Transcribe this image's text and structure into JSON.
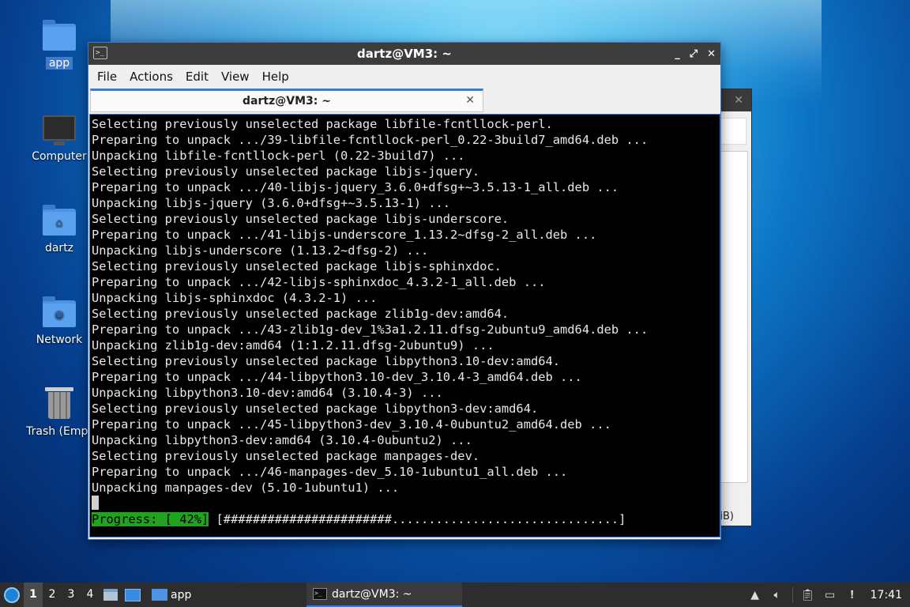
{
  "desktop": {
    "icons": [
      {
        "label": "app"
      },
      {
        "label": "Computer"
      },
      {
        "label": "dartz"
      },
      {
        "label": "Network"
      },
      {
        "label": "Trash (Empt"
      }
    ]
  },
  "background_window": {
    "close_glyph": "✕",
    "partial_text": "iB)"
  },
  "terminal_window": {
    "title": "dartz@VM3: ~",
    "controls": {
      "minimize": "_",
      "maximize": "⤢",
      "close": "✕"
    },
    "menu": [
      "File",
      "Actions",
      "Edit",
      "View",
      "Help"
    ],
    "tab": {
      "label": "dartz@VM3: ~",
      "close": "✕"
    },
    "lines": [
      "Selecting previously unselected package libfile-fcntllock-perl.",
      "Preparing to unpack .../39-libfile-fcntllock-perl_0.22-3build7_amd64.deb ...",
      "Unpacking libfile-fcntllock-perl (0.22-3build7) ...",
      "Selecting previously unselected package libjs-jquery.",
      "Preparing to unpack .../40-libjs-jquery_3.6.0+dfsg+~3.5.13-1_all.deb ...",
      "Unpacking libjs-jquery (3.6.0+dfsg+~3.5.13-1) ...",
      "Selecting previously unselected package libjs-underscore.",
      "Preparing to unpack .../41-libjs-underscore_1.13.2~dfsg-2_all.deb ...",
      "Unpacking libjs-underscore (1.13.2~dfsg-2) ...",
      "Selecting previously unselected package libjs-sphinxdoc.",
      "Preparing to unpack .../42-libjs-sphinxdoc_4.3.2-1_all.deb ...",
      "Unpacking libjs-sphinxdoc (4.3.2-1) ...",
      "Selecting previously unselected package zlib1g-dev:amd64.",
      "Preparing to unpack .../43-zlib1g-dev_1%3a1.2.11.dfsg-2ubuntu9_amd64.deb ...",
      "Unpacking zlib1g-dev:amd64 (1:1.2.11.dfsg-2ubuntu9) ...",
      "Selecting previously unselected package libpython3.10-dev:amd64.",
      "Preparing to unpack .../44-libpython3.10-dev_3.10.4-3_amd64.deb ...",
      "Unpacking libpython3.10-dev:amd64 (3.10.4-3) ...",
      "Selecting previously unselected package libpython3-dev:amd64.",
      "Preparing to unpack .../45-libpython3-dev_3.10.4-0ubuntu2_amd64.deb ...",
      "Unpacking libpython3-dev:amd64 (3.10.4-0ubuntu2) ...",
      "Selecting previously unselected package manpages-dev.",
      "Preparing to unpack .../46-manpages-dev_5.10-1ubuntu1_all.deb ...",
      "Unpacking manpages-dev (5.10-1ubuntu1) ..."
    ],
    "progress": {
      "label": "Progress: [ 42%]",
      "bar": " [#######################...............................]",
      "percent": 42
    }
  },
  "taskbar": {
    "workspaces": [
      "1",
      "2",
      "3",
      "4"
    ],
    "active_workspace": "1",
    "app_button": "app",
    "terminal_task": "dartz@VM3: ~",
    "clock": "17:41"
  }
}
